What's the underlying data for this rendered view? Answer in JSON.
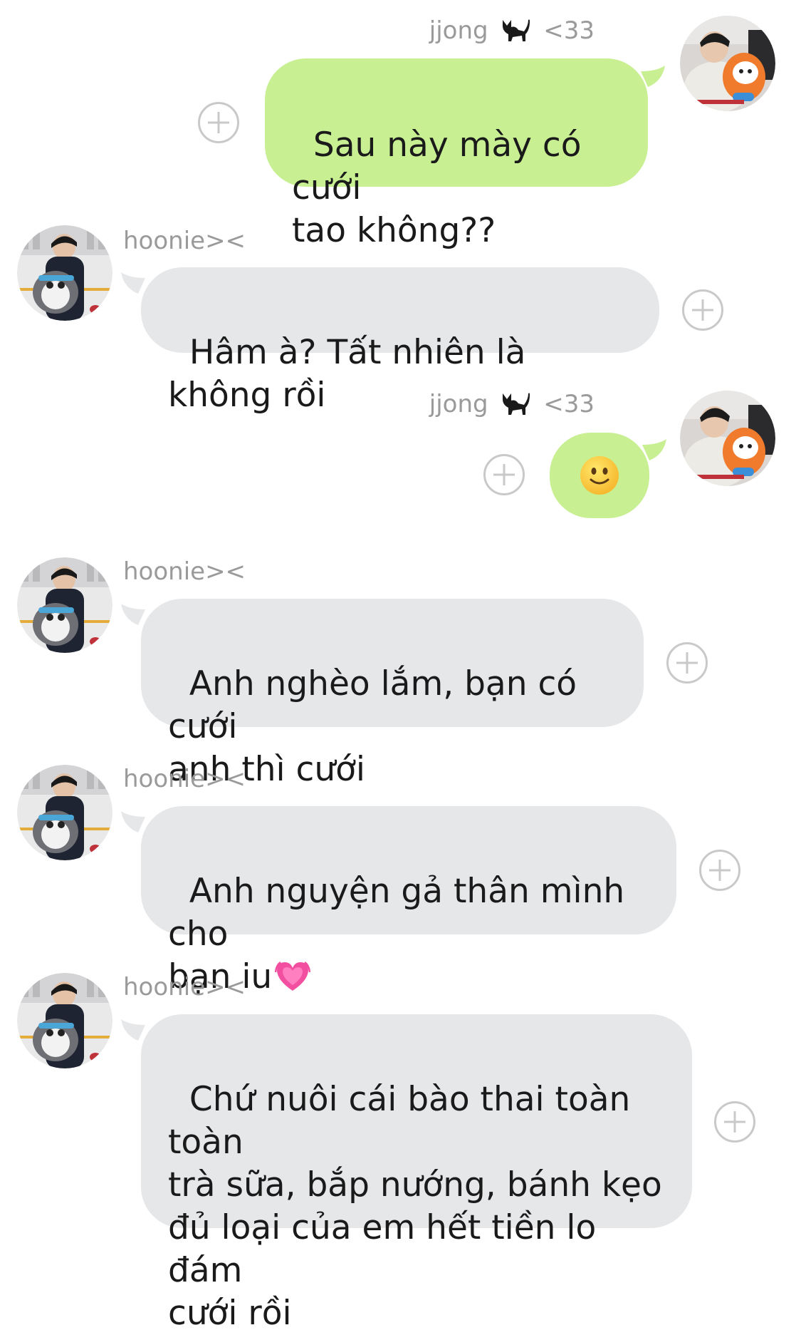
{
  "colors": {
    "my_bubble": "#c8f093",
    "their_bubble": "#e6e7e9",
    "sender_name": "#9a9a9a",
    "add_button": "#c9c9c9"
  },
  "messages": [
    {
      "sender": "jjong",
      "sender_suffix": "<33",
      "sender_emoji": "black-cat-icon",
      "text": "Sau này mày có cưới\ntao không??"
    },
    {
      "sender": "hoonie><",
      "text": "Hâm à? Tất nhiên là không rồi"
    },
    {
      "sender": "jjong",
      "sender_suffix": "<33",
      "sender_emoji": "black-cat-icon",
      "text": "",
      "emoji": "slightly-smiling-face-icon"
    },
    {
      "sender": "hoonie><",
      "text": "Anh nghèo lắm, bạn có cưới\nanh thì cưới"
    },
    {
      "sender": "hoonie><",
      "text": "Anh nguyện gả thân mình cho\nbạn iu",
      "trailing_emoji": "growing-heart-icon"
    },
    {
      "sender": "hoonie><",
      "text": "Chứ nuôi cái bào thai toàn toàn\ntrà sữa, bắp nướng, bánh kẹo\nđủ loại của em hết tiền lo đám\ncưới rồi"
    }
  ]
}
